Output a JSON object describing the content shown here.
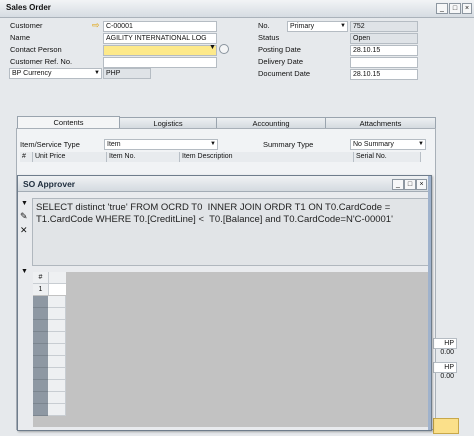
{
  "window": {
    "title": "Sales Order"
  },
  "header_left": {
    "customer": {
      "label": "Customer",
      "value": "C-00001"
    },
    "name": {
      "label": "Name",
      "value": "AGILITY INTERNATIONAL LOG"
    },
    "contact_person": {
      "label": "Contact Person",
      "value": ""
    },
    "customer_ref": {
      "label": "Customer Ref. No.",
      "value": ""
    },
    "currency": {
      "label": "BP Currency",
      "value": "PHP"
    }
  },
  "header_right": {
    "no": {
      "label": "No.",
      "series": "Primary",
      "value": "752"
    },
    "status": {
      "label": "Status",
      "value": "Open"
    },
    "posting_date": {
      "label": "Posting Date",
      "value": "28.10.15"
    },
    "delivery_date": {
      "label": "Delivery Date",
      "value": ""
    },
    "document_date": {
      "label": "Document Date",
      "value": "28.10.15"
    }
  },
  "tabs": [
    "Contents",
    "Logistics",
    "Accounting",
    "Attachments"
  ],
  "contents": {
    "item_type_label": "Item/Service Type",
    "item_type_value": "Item",
    "summary_type_label": "Summary Type",
    "summary_type_value": "No Summary",
    "columns": [
      "#",
      "Unit Price",
      "Item No.",
      "Item Description",
      "Serial No."
    ]
  },
  "dialog": {
    "title": "SO Approver",
    "query": "SELECT distinct 'true' FROM OCRD T0  INNER JOIN ORDR T1 ON T0.CardCode = T1.CardCode WHERE T0.[CreditLine] <  T0.[Balance] and T0.CardCode=N'C-00001'",
    "result_header": "#",
    "result_rows": [
      "1"
    ]
  },
  "totals": [
    "HP 0.00",
    "HP 0.00"
  ]
}
